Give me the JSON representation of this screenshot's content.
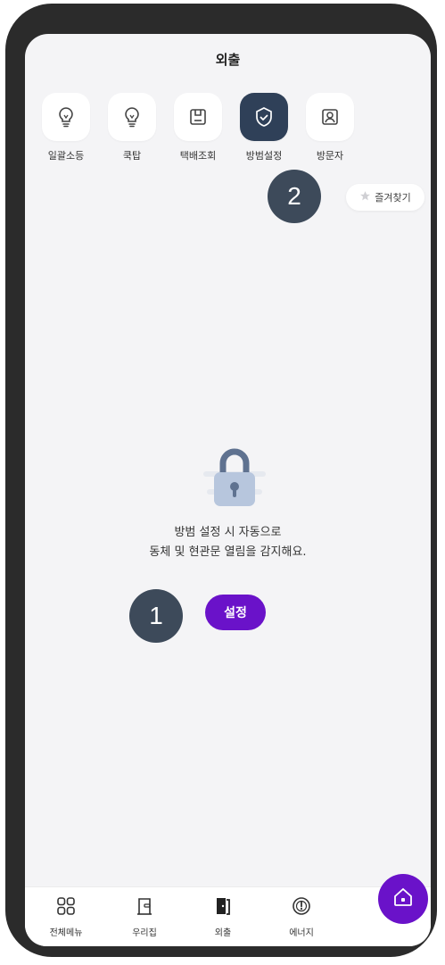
{
  "header": {
    "title": "외출"
  },
  "menu": [
    {
      "label": "일괄소등",
      "icon": "lightbulb-icon",
      "active": false
    },
    {
      "label": "쿡탑",
      "icon": "lightbulb-icon",
      "active": false
    },
    {
      "label": "택배조회",
      "icon": "parcel-box-icon",
      "active": false
    },
    {
      "label": "방범설정",
      "icon": "security-shield-icon",
      "active": true
    },
    {
      "label": "방문자",
      "icon": "visitor-portrait-icon",
      "active": false
    }
  ],
  "favorites_button": {
    "label": "즐겨찾기",
    "icon": "star-icon"
  },
  "annotations": {
    "badge_1": "1",
    "badge_2": "2"
  },
  "main": {
    "message_line1": "방범 설정 시 자동으로",
    "message_line2": "동체 및 현관문 열림을 감지해요.",
    "set_button_label": "설정"
  },
  "bottom_nav": [
    {
      "label": "전체메뉴",
      "icon": "grid-menu-icon"
    },
    {
      "label": "우리집",
      "icon": "door-icon"
    },
    {
      "label": "외출",
      "icon": "exit-door-icon"
    },
    {
      "label": "에너지",
      "icon": "energy-gauge-icon"
    }
  ],
  "colors": {
    "accent": "#6a12c9",
    "active_menu": "#2f4058",
    "badge": "#3d4a5a",
    "background": "#f4f4f6"
  }
}
